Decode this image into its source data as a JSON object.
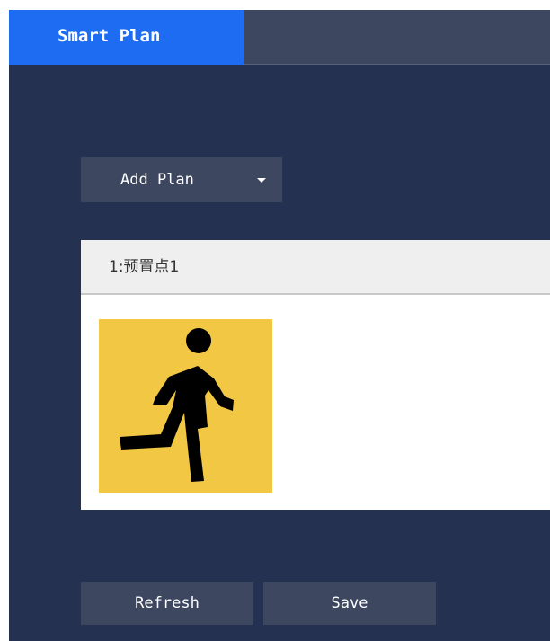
{
  "tabs": [
    {
      "label": "Smart Plan",
      "active": true
    }
  ],
  "add_plan": {
    "label": "Add Plan"
  },
  "plan": {
    "title": "1:预置点1",
    "icon": "running-person-icon",
    "icon_background": "#f2c744"
  },
  "buttons": {
    "refresh": "Refresh",
    "save": "Save"
  },
  "colors": {
    "background": "#253150",
    "tab_active": "#1e6cf1",
    "control": "#3d4760"
  }
}
